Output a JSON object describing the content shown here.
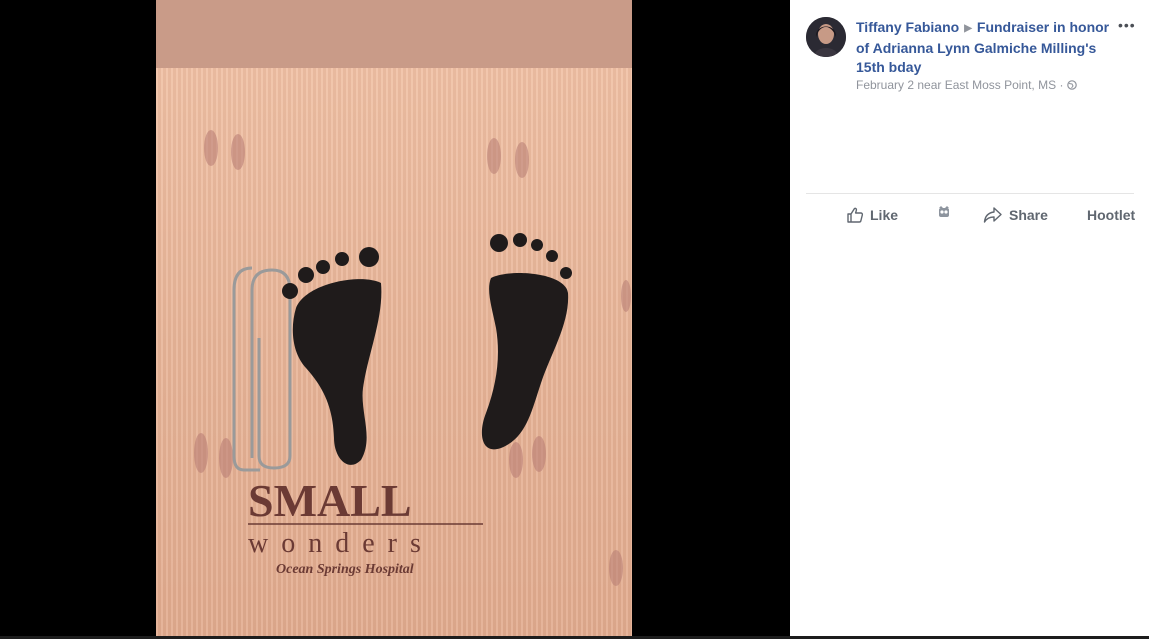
{
  "photo": {
    "card_brand_line1": "SMALL",
    "card_brand_line2": "wonders",
    "card_brand_line3": "Ocean Springs Hospital"
  },
  "post": {
    "author": "Tiffany Fabiano",
    "title": "Fundraiser in honor of Adrianna Lynn Galmiche Milling's 15th bday",
    "meta_date": "February 2",
    "meta_location": "near East Moss Point, MS",
    "meta_separator": "·",
    "privacy_icon": "globe-icon",
    "more_label": "•••"
  },
  "actions": {
    "like_label": "Like",
    "share_label": "Share",
    "hootlet_label": "Hootlet"
  },
  "colors": {
    "link_blue": "#365899",
    "meta_gray": "#90949c",
    "action_gray": "#606770",
    "footprint_ink": "#1f1b1b",
    "card_ink": "#6b3a34"
  }
}
